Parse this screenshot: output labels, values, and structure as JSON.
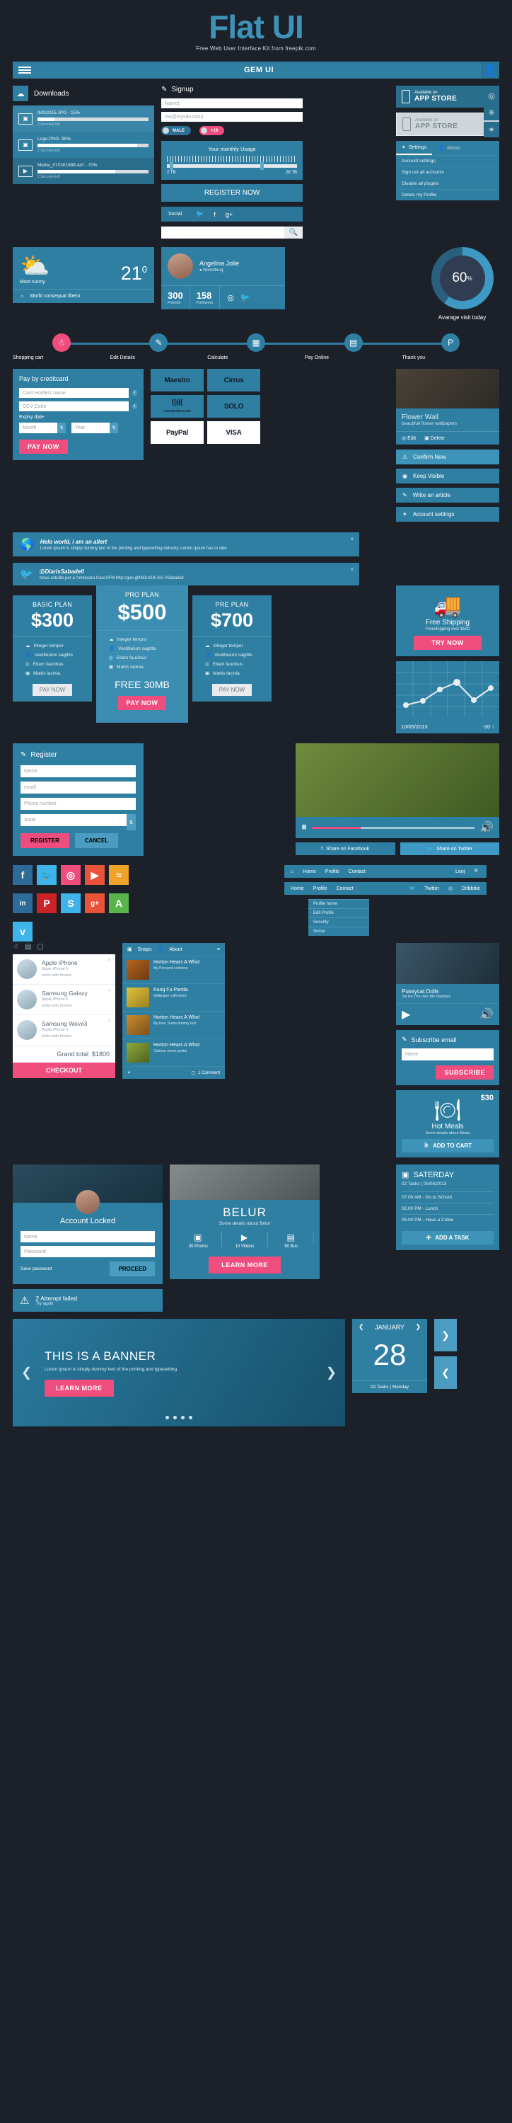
{
  "hero": {
    "title": "Flat UI",
    "subtitle": "Free Web User Interface Kit from freepik.com"
  },
  "navbar": {
    "title": "GEM UI",
    "burger_icon": "hamburger-icon",
    "user_icon": "user-icon"
  },
  "sidecol": [
    {
      "icon": "compass-icon",
      "glyph": "◍"
    },
    {
      "icon": "microphone-icon",
      "glyph": "🎤"
    },
    {
      "icon": "gear-icon",
      "glyph": "✿"
    }
  ],
  "downloads": {
    "title": "Downloads",
    "items": [
      {
        "name": "IMG3015.JPG - 15%",
        "percent": 15,
        "time_left": "2 Seconds left",
        "icon": "image-file-icon"
      },
      {
        "name": "Logo.PNG- 90%",
        "percent": 90,
        "time_left": "2 Seconds left",
        "icon": "image-file-icon"
      },
      {
        "name": "Media_07/03/1988.AVI - 70%",
        "percent": 70,
        "time_left": "2 Seconds left",
        "icon": "video-file-icon"
      }
    ]
  },
  "signup": {
    "title": "Signup",
    "name_placeholder": "Name|",
    "email_placeholder": "me@mysite.com|",
    "toggle_male": "MALE",
    "toggle_age": "+18",
    "usage_title": "Your monthly Usage",
    "usage_min": "2 TB",
    "usage_max": "28 TB",
    "register_label": "REGISTER NOW",
    "social_label": "Social",
    "search_placeholder": ""
  },
  "appstore": [
    {
      "line1": "Available on",
      "line2": "APP STORE",
      "style": "dark"
    },
    {
      "line1": "Available on",
      "line2": "APP STORE",
      "style": "light"
    }
  ],
  "settings": {
    "tabs": [
      {
        "label": "Settings",
        "icon": "gear-icon",
        "active": true
      },
      {
        "label": "About",
        "icon": "user-icon",
        "active": false
      }
    ],
    "items": [
      "Account settings",
      "Sign out all accounts",
      "Disable all plugins",
      "Delete my Profile"
    ]
  },
  "weather": {
    "condition": "Most sunny",
    "temperature": "21",
    "degree": "0",
    "footer": "Morbi consequat libero",
    "icon": "sun-cloud-icon"
  },
  "profile": {
    "name": "Angelina Jolie",
    "location": "Noordbrug",
    "stats": [
      {
        "value": "300",
        "label": "Friends"
      },
      {
        "value": "158",
        "label": "Followers"
      }
    ],
    "icons": [
      "dribbble-icon",
      "twitter-icon"
    ]
  },
  "gauge": {
    "value": "60",
    "unit": "%",
    "percent": 60,
    "label": "Avarage visit today",
    "color": "#3e9ac4"
  },
  "steps": [
    {
      "label": "Shopping cart",
      "icon": "basket-icon",
      "glyph": "⛁",
      "active": true
    },
    {
      "label": "Edit Details",
      "icon": "edit-icon",
      "glyph": "✎",
      "active": false
    },
    {
      "label": "Calculate",
      "icon": "calculator-icon",
      "glyph": "▦",
      "active": false
    },
    {
      "label": "Pay Online",
      "icon": "card-icon",
      "glyph": "▤",
      "active": false
    },
    {
      "label": "Thank you",
      "icon": "paypal-icon",
      "glyph": "P",
      "active": false
    }
  ],
  "creditcard": {
    "title": "Pay by creditcard",
    "holder_placeholder": "Card Holders name",
    "ccv_placeholder": "CCV Code",
    "expiry_label": "Expiry date",
    "month_placeholder": "Month",
    "year_placeholder": "Year",
    "pay_label": "PAY NOW"
  },
  "card_logos": [
    {
      "name": "Maestro",
      "sub": ""
    },
    {
      "name": "Cirrus",
      "sub": ""
    },
    {
      "name": "(((((",
      "sub": "moneybookers.com"
    },
    {
      "name": "SOLO",
      "sub": ""
    },
    {
      "name": "PayPal",
      "sub": ""
    },
    {
      "name": "VISA",
      "sub": ""
    }
  ],
  "flowerwall": {
    "title": "Flower Wall",
    "subtitle": "beautifull flower wallpapers",
    "edit": "Edit",
    "delete": "Delete"
  },
  "action_buttons": [
    {
      "label": "Confirm Now",
      "icon": "warning-icon",
      "glyph": "⚠",
      "style": "light"
    },
    {
      "label": "Keep Visible",
      "icon": "eye-icon",
      "glyph": "◉",
      "style": "dark"
    },
    {
      "label": "Write an article",
      "icon": "edit-icon",
      "glyph": "✎",
      "style": "dark"
    },
    {
      "label": "Account settings",
      "icon": "gear-icon",
      "glyph": "✿",
      "style": "dark"
    }
  ],
  "alerts": [
    {
      "icon": "globe-icon",
      "glyph": "🌐",
      "title": "Helo world, i am an allert",
      "body": "Lorem Ipsum is simply dummy text of the printing and typesetting industry. Lorem Ipsum has in side",
      "close": "×"
    },
    {
      "icon": "twitter-icon",
      "glyph": "🐦",
      "title": "@DiarisSabadell",
      "body": "Nous estudis per a l'emissora Can10FM http://goo.gl/fbGUG9i  #iG #Sabadell",
      "close": "×"
    }
  ],
  "plans": [
    {
      "name": "BASIC PLAN",
      "price": "$300",
      "features": [
        "Integer tempor",
        "Vestibulum sagittis",
        "Etiam faucibus",
        "Mattis lacinia."
      ],
      "button": "PAY NOW",
      "featured": false,
      "free": ""
    },
    {
      "name": "PRO PLAN",
      "price": "$500",
      "features": [
        "Integer tempor",
        "Vestibulum sagittis",
        "Etiam faucibus",
        "Mattis lacinia."
      ],
      "button": "PAY NOW",
      "featured": true,
      "free": "FREE 30MB"
    },
    {
      "name": "PRE PLAN",
      "price": "$700",
      "features": [
        "Integer tempor",
        "Vestibulum sagittis",
        "Etiam faucibus",
        "Mattis lacinia."
      ],
      "button": "PAY NOW",
      "featured": false,
      "free": ""
    }
  ],
  "shipping": {
    "title": "Free Shipping",
    "subtitle": "Freeshipping over $500",
    "button": "TRY NOW",
    "icon": "truck-icon"
  },
  "chart_data": {
    "type": "line",
    "x": [
      0,
      1,
      2,
      3,
      4,
      5,
      6
    ],
    "values": [
      20,
      30,
      55,
      70,
      38,
      60,
      60
    ],
    "title": "",
    "date_label": "10/05/2013",
    "delta_label": "-20",
    "trend": "up",
    "grid": true,
    "ylim": [
      0,
      100
    ]
  },
  "register": {
    "title": "Register",
    "name_placeholder": "Name",
    "email_placeholder": "email",
    "phone_placeholder": "Phone number",
    "state_placeholder": "State",
    "register_label": "REGISTER",
    "cancel_label": "CANCEL"
  },
  "video": {
    "share_facebook": "Share on Facebook",
    "share_twitter": "Share on Twitter",
    "play_icon": "pause-icon",
    "volume_icon": "volume-icon"
  },
  "socials": [
    {
      "name": "facebook",
      "glyph": "f",
      "color": "#2d6c99"
    },
    {
      "name": "twitter",
      "glyph": "t",
      "color": "#3eb4ea"
    },
    {
      "name": "dribbble",
      "glyph": "◉",
      "color": "#ee4d7e"
    },
    {
      "name": "youtube",
      "glyph": "▶",
      "color": "#e8533a"
    },
    {
      "name": "rss",
      "glyph": "≋",
      "color": "#f0a32a"
    },
    {
      "name": "linkedin",
      "glyph": "in",
      "color": "#2d6c99"
    },
    {
      "name": "pinterest",
      "glyph": "P",
      "color": "#cc2127"
    },
    {
      "name": "skype",
      "glyph": "S",
      "color": "#3eb4ea"
    },
    {
      "name": "googleplus",
      "glyph": "g+",
      "color": "#e8533a"
    },
    {
      "name": "android",
      "glyph": "A",
      "color": "#59b54b"
    },
    {
      "name": "vimeo",
      "glyph": "v",
      "color": "#3eb4ea"
    }
  ],
  "menubar": {
    "items": [
      "Home",
      "Profile",
      "Contact"
    ],
    "home_icon": "home-icon",
    "user_text": "Leoj",
    "search_icon": "search-icon"
  },
  "menubar2": {
    "items": [
      "Home",
      "Profile",
      "Contact"
    ],
    "twitter_label": "Twitter",
    "dribbble_label": "Dribbble",
    "dropdown": [
      "Profile home",
      "Edit Profile",
      "Security",
      "Social"
    ]
  },
  "cart": {
    "items": [
      {
        "title": "Apple iPhone",
        "line1": "Apple iPhone 5",
        "line2": "white with freebie"
      },
      {
        "title": "Samsung Galaxy",
        "line1": "Apple iPhone 5",
        "line2": "white with freebie"
      },
      {
        "title": "Samsung Wave3",
        "line1": "Apple iPhone 5",
        "line2": "white with freebie"
      }
    ],
    "grand_total_label": "Grand total",
    "grand_total_value": "$1800",
    "checkout": "CHECKOUT"
  },
  "news": {
    "tabs": [
      {
        "label": "Snaps",
        "icon": "camera-icon"
      },
      {
        "label": "About",
        "icon": "user-icon"
      }
    ],
    "items": [
      {
        "title": "Horton Hears A Who!",
        "subtitle": "My Personal cartoons"
      },
      {
        "title": "Kung Fu Panda",
        "subtitle": "Wallpaper collections"
      },
      {
        "title": "Horton Hears A Who!",
        "subtitle": "My love, Some dummy text"
      },
      {
        "title": "Horton Hears A Who!",
        "subtitle": "Cartoon movie poster"
      }
    ],
    "footer_icon": "gear-icon",
    "comments": "1 Comment"
  },
  "music": {
    "artist": "Pussycat Dolls",
    "track": "Jai Ho (You Are My Destiny)",
    "play_icon": "play-icon",
    "volume_icon": "volume-icon"
  },
  "subscribe": {
    "title": "Subscribe email",
    "placeholder": "Name",
    "button": "SUBSCRIBE"
  },
  "meal": {
    "price": "$30",
    "title": "Hot Meals",
    "subtitle": "Some details about Meals",
    "button": "ADD TO CART",
    "icon": "dish-icon"
  },
  "locked": {
    "title": "Account Locked",
    "name_placeholder": "Name",
    "password_placeholder": "Password",
    "save_label": "Save password",
    "proceed_label": "PROCEED",
    "fail_title": "2 Attempt failed",
    "fail_sub": "Try again"
  },
  "belur": {
    "title": "BELUR",
    "subtitle": "Some details about Belur",
    "stats": [
      {
        "value": "30 Photos",
        "icon": "camera-icon",
        "glyph": "📷"
      },
      {
        "value": "10 Videos",
        "icon": "video-icon",
        "glyph": "🎥"
      },
      {
        "value": "80 Bus",
        "icon": "bus-icon",
        "glyph": "🚌"
      }
    ],
    "button": "LEARN MORE"
  },
  "saturday": {
    "title": "SATERDAY",
    "subtitle": "02 Tasks |  05/05/2013",
    "tasks": [
      "07.00 AM  -  Go to School",
      "02.00 PM  -  Lunch",
      "05.00 PM  -  Have a Cofee"
    ],
    "button": "ADD A TASK"
  },
  "banner": {
    "title": "THIS IS A BANNER",
    "subtitle": "Lorem Ipsum is simply dummy text of the printing and typesetting",
    "button": "LEARN MORE",
    "prev": "❮",
    "next": "❯",
    "dots": 4
  },
  "calendar": {
    "month": "JANUARY",
    "day": "28",
    "footer": "02 Tasks |  Monday",
    "prev": "❮",
    "next": "❯"
  }
}
